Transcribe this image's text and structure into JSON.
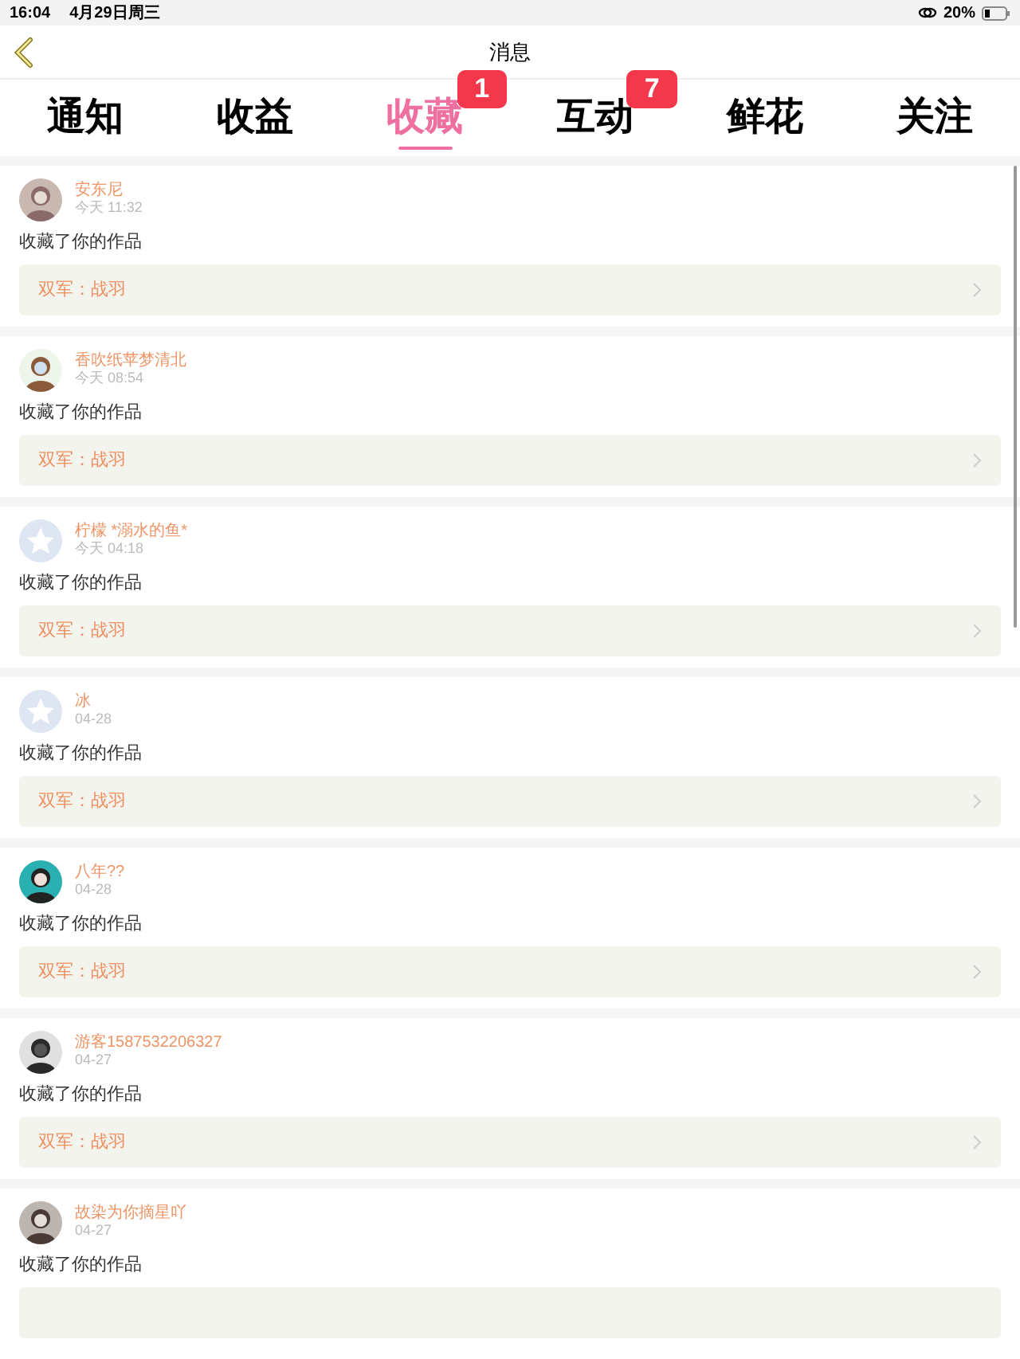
{
  "status_bar": {
    "time": "16:04",
    "date": "4月29日周三",
    "battery": "20%"
  },
  "nav": {
    "title": "消息"
  },
  "tabs": [
    {
      "label": "通知",
      "selected": false
    },
    {
      "label": "收益",
      "selected": false
    },
    {
      "label": "收藏",
      "selected": true,
      "badge": "1"
    },
    {
      "label": "互动",
      "selected": false,
      "badge": "7"
    },
    {
      "label": "鲜花",
      "selected": false
    },
    {
      "label": "关注",
      "selected": false
    }
  ],
  "messages": [
    {
      "user": "安东尼",
      "time": "今天 11:32",
      "text": "收藏了你的作品",
      "work": "双军：战羽"
    },
    {
      "user": "香吹纸苹梦清北",
      "time": "今天 08:54",
      "text": "收藏了你的作品",
      "work": "双军：战羽"
    },
    {
      "user": "柠檬 *溺水的鱼*",
      "time": "今天 04:18",
      "avatar": {
        "kind": "default"
      },
      "text": "收藏了你的作品",
      "work": "双军：战羽"
    },
    {
      "user": "冰",
      "time": "04-28",
      "avatar": {
        "kind": "default"
      },
      "text": "收藏了你的作品",
      "work": "双军：战羽"
    },
    {
      "user": "八年??",
      "time": "04-28",
      "text": "收藏了你的作品",
      "work": "双军：战羽"
    },
    {
      "user": "游客1587532206327",
      "time": "04-27",
      "text": "收藏了你的作品",
      "work": "双军：战羽"
    },
    {
      "user": "故染为你摘星吖",
      "time": "04-27",
      "text": "收藏了你的作品"
    }
  ]
}
